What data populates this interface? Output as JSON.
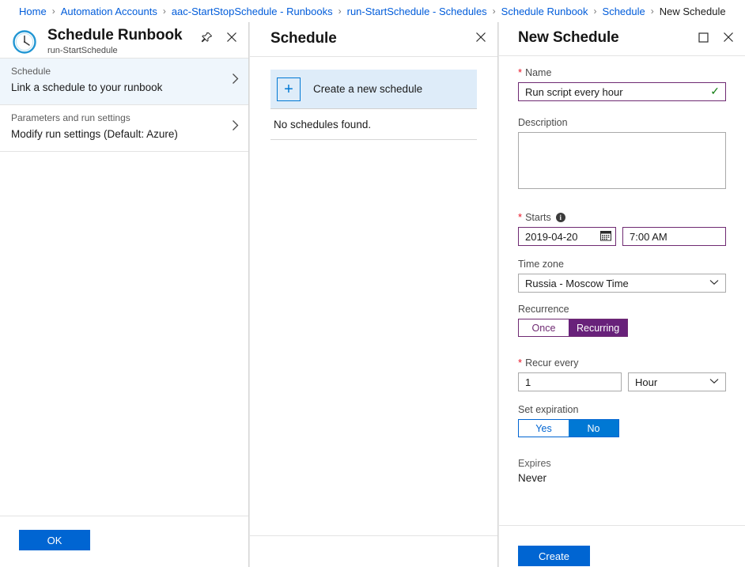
{
  "breadcrumb": {
    "separator": "›",
    "items": [
      {
        "label": "Home",
        "current": false
      },
      {
        "label": "Automation Accounts",
        "current": false
      },
      {
        "label": "aac-StartStopSchedule - Runbooks",
        "current": false
      },
      {
        "label": "run-StartSchedule - Schedules",
        "current": false
      },
      {
        "label": "Schedule Runbook",
        "current": false
      },
      {
        "label": "Schedule",
        "current": false
      },
      {
        "label": "New Schedule",
        "current": true
      }
    ]
  },
  "left_panel": {
    "icon": "clock-icon",
    "title": "Schedule Runbook",
    "subtitle": "run-StartSchedule",
    "pin_icon": "pin-icon",
    "close_icon": "close-icon",
    "items": [
      {
        "label": "Schedule",
        "value": "Link a schedule to your runbook",
        "selected": true,
        "chevron": "chevron-right-icon"
      },
      {
        "label": "Parameters and run settings",
        "value": "Modify run settings (Default: Azure)",
        "selected": false,
        "chevron": "chevron-right-icon"
      }
    ],
    "ok_label": "OK"
  },
  "middle_panel": {
    "title": "Schedule",
    "close_icon": "close-icon",
    "create_icon": "plus-icon",
    "create_label": "Create a new schedule",
    "empty_text": "No schedules found."
  },
  "right_panel": {
    "title": "New Schedule",
    "maximize_icon": "maximize-icon",
    "close_icon": "close-icon",
    "name": {
      "label": "Name",
      "required": true,
      "value": "Run script every hour",
      "placeholder": "",
      "valid_icon": "check-icon"
    },
    "description": {
      "label": "Description",
      "required": false,
      "value": "",
      "placeholder": ""
    },
    "starts": {
      "label": "Starts",
      "required": true,
      "info_icon": "info-icon",
      "date_value": "2019-04-20",
      "calendar_icon": "calendar-icon",
      "time_value": "7:00 AM"
    },
    "time_zone": {
      "label": "Time zone",
      "required": false,
      "value": "Russia - Moscow Time",
      "caret": "chevron-down-icon"
    },
    "recurrence": {
      "label": "Recurrence",
      "required": false,
      "options": [
        "Once",
        "Recurring"
      ],
      "selected": "Recurring"
    },
    "recur_every": {
      "label": "Recur every",
      "required": true,
      "interval_value": "1",
      "unit_value": "Hour",
      "caret": "chevron-down-icon"
    },
    "set_expiration": {
      "label": "Set expiration",
      "required": false,
      "options": [
        "Yes",
        "No"
      ],
      "selected": "No"
    },
    "expires": {
      "label": "Expires",
      "value": "Never"
    },
    "create_label": "Create"
  },
  "colors": {
    "link_blue": "#015cda",
    "button_blue": "#0065d2",
    "accent_purple": "#68217a",
    "field_purple": "#6f2a72",
    "selected_row_blue": "#eff6fc",
    "create_row_blue": "#deecf9",
    "required_red": "#e81123",
    "valid_green": "#107c10"
  }
}
